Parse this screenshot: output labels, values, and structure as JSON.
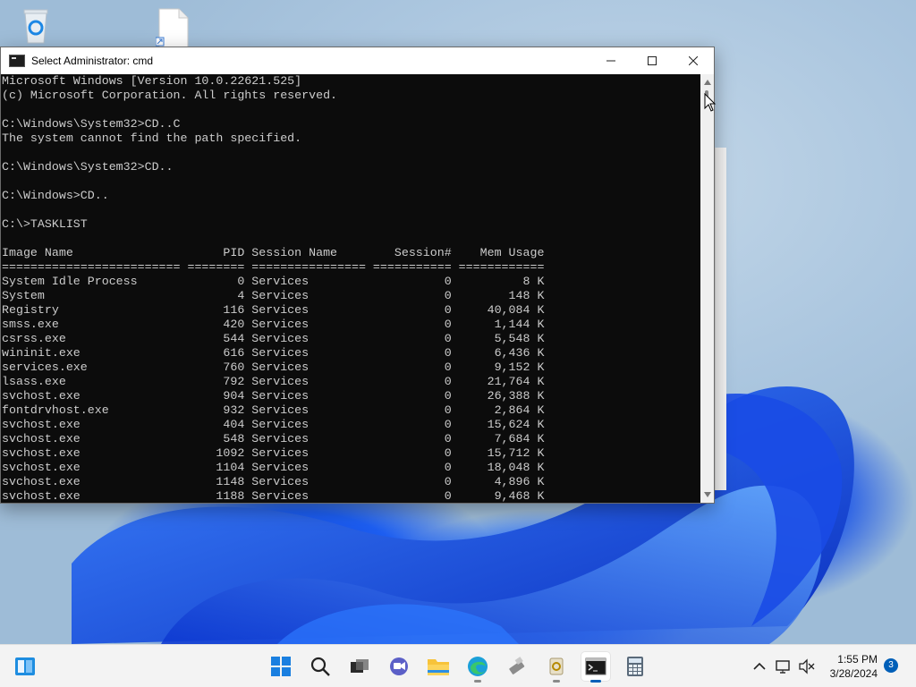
{
  "window": {
    "title": "Select Administrator: cmd",
    "minimize": "—",
    "maximize": "☐",
    "close": "✕"
  },
  "console_lines": [
    "Microsoft Windows [Version 10.0.22621.525]",
    "(c) Microsoft Corporation. All rights reserved.",
    "",
    "C:\\Windows\\System32>CD..C",
    "The system cannot find the path specified.",
    "",
    "C:\\Windows\\System32>CD..",
    "",
    "C:\\Windows>CD..",
    "",
    "C:\\>TASKLIST",
    "",
    "Image Name                     PID Session Name        Session#    Mem Usage",
    "========================= ======== ================ =========== ============",
    "System Idle Process              0 Services                   0          8 K",
    "System                           4 Services                   0        148 K",
    "Registry                       116 Services                   0     40,084 K",
    "smss.exe                       420 Services                   0      1,144 K",
    "csrss.exe                      544 Services                   0      5,548 K",
    "wininit.exe                    616 Services                   0      6,436 K",
    "services.exe                   760 Services                   0      9,152 K",
    "lsass.exe                      792 Services                   0     21,764 K",
    "svchost.exe                    904 Services                   0     26,388 K",
    "fontdrvhost.exe                932 Services                   0      2,864 K",
    "svchost.exe                    404 Services                   0     15,624 K",
    "svchost.exe                    548 Services                   0      7,684 K",
    "svchost.exe                   1092 Services                   0     15,712 K",
    "svchost.exe                   1104 Services                   0     18,048 K",
    "svchost.exe                   1148 Services                   0      4,896 K",
    "svchost.exe                   1188 Services                   0      9,468 K"
  ],
  "taskbar": {
    "icons": [
      "widgets-icon",
      "start-icon",
      "search-icon",
      "task-view-icon",
      "chat-icon",
      "file-explorer-icon",
      "edge-icon",
      "usb-tool-icon",
      "recycle-tool-icon",
      "cmd-icon",
      "calculator-icon"
    ],
    "time": "1:55 PM",
    "date": "3/28/2024",
    "notification_count": "3"
  },
  "colors": {
    "console_bg": "#0c0c0c",
    "console_fg": "#cccccc",
    "accent": "#005fb8"
  }
}
